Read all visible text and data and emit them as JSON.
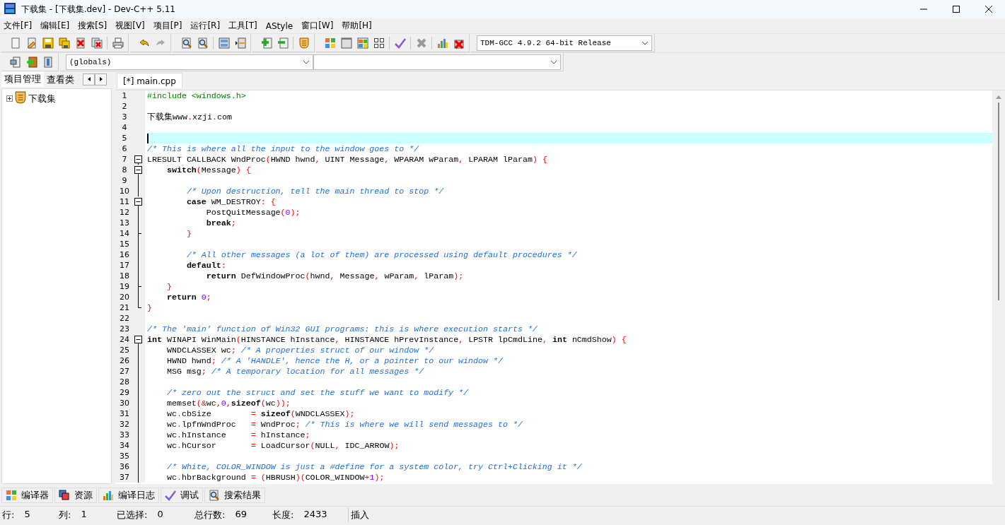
{
  "window": {
    "title": "下载集 - [下载集.dev] - Dev-C++ 5.11"
  },
  "menu": [
    "文件[F]",
    "编辑[E]",
    "搜索[S]",
    "视图[V]",
    "项目[P]",
    "运行[R]",
    "工具[T]",
    "AStyle",
    "窗口[W]",
    "帮助[H]"
  ],
  "toolbar": {
    "compiler": "TDM-GCC 4.9.2 64-bit Release"
  },
  "class_bar": {
    "scope": "(globals)"
  },
  "side_panel": {
    "tabs": [
      {
        "label": "项目管理",
        "selected": true
      },
      {
        "label": "查看类",
        "selected": false
      }
    ],
    "tree": [
      {
        "label": "下载集",
        "expanded": false
      }
    ]
  },
  "editor": {
    "tabs": [
      {
        "label": "[*] main.cpp",
        "selected": true
      }
    ],
    "lines": [
      {
        "number": "1",
        "kind": "plain",
        "current": false,
        "segments": [
          {
            "kind": "pp",
            "text": "#include <windows.h>"
          }
        ]
      },
      {
        "number": "2",
        "kind": "plain",
        "current": false
      },
      {
        "number": "3",
        "kind": "plain",
        "current": false,
        "segments": [
          {
            "kind": "pl",
            "text": "下载集www"
          },
          {
            "kind": "sym",
            "text": "."
          },
          {
            "kind": "pl",
            "text": "xzji"
          },
          {
            "kind": "sym",
            "text": "."
          },
          {
            "kind": "pl",
            "text": "com"
          }
        ]
      },
      {
        "number": "4",
        "kind": "plain",
        "current": false
      },
      {
        "number": "5",
        "kind": "plain",
        "current": true
      },
      {
        "number": "6",
        "kind": "plain",
        "current": false,
        "segments": [
          {
            "kind": "cm",
            "text": "/* This is where all the input to the window goes to */"
          }
        ]
      },
      {
        "number": "7",
        "kind": "fold-start",
        "current": false,
        "segments": [
          {
            "kind": "pl",
            "text": "LRESULT CALLBACK WndProc"
          },
          {
            "kind": "sym",
            "text": "("
          },
          {
            "kind": "pl",
            "text": "HWND hwnd"
          },
          {
            "kind": "sym",
            "text": ","
          },
          {
            "kind": "pl",
            "text": " UINT Message"
          },
          {
            "kind": "sym",
            "text": ","
          },
          {
            "kind": "pl",
            "text": " WPARAM wParam"
          },
          {
            "kind": "sym",
            "text": ","
          },
          {
            "kind": "pl",
            "text": " LPARAM lParam"
          },
          {
            "kind": "sym",
            "text": ")"
          },
          {
            "kind": "sym",
            "text": " {"
          }
        ]
      },
      {
        "number": "8",
        "kind": "fold-start",
        "current": false,
        "segments": [
          {
            "kind": "kw",
            "text": "    switch"
          },
          {
            "kind": "sym",
            "text": "("
          },
          {
            "kind": "pl",
            "text": "Message"
          },
          {
            "kind": "sym",
            "text": ")"
          },
          {
            "kind": "sym",
            "text": " {"
          }
        ]
      },
      {
        "number": "9",
        "kind": "fold-body",
        "current": false
      },
      {
        "number": "10",
        "kind": "fold-body",
        "current": false,
        "segments": [
          {
            "kind": "cm",
            "text": "        /* Upon destruction, tell the main thread to stop */"
          }
        ]
      },
      {
        "number": "11",
        "kind": "fold-start",
        "current": false,
        "segments": [
          {
            "kind": "kw",
            "text": "        case"
          },
          {
            "kind": "pl",
            "text": " WM_DESTROY"
          },
          {
            "kind": "sym",
            "text": ":"
          },
          {
            "kind": "sym",
            "text": " {"
          }
        ]
      },
      {
        "number": "12",
        "kind": "fold-body",
        "current": false,
        "segments": [
          {
            "kind": "pl",
            "text": "            PostQuitMessage"
          },
          {
            "kind": "sym",
            "text": "("
          },
          {
            "kind": "num",
            "text": "0"
          },
          {
            "kind": "sym",
            "text": ");"
          }
        ]
      },
      {
        "number": "13",
        "kind": "fold-body",
        "current": false,
        "segments": [
          {
            "kind": "kw",
            "text": "            break"
          },
          {
            "kind": "sym",
            "text": ";"
          }
        ]
      },
      {
        "number": "14",
        "kind": "fold-end",
        "current": false,
        "segments": [
          {
            "kind": "sym",
            "text": "        }"
          }
        ]
      },
      {
        "number": "15",
        "kind": "fold-body",
        "current": false
      },
      {
        "number": "16",
        "kind": "fold-body",
        "current": false,
        "segments": [
          {
            "kind": "cm",
            "text": "        /* All other messages (a lot of them) are processed using default procedures */"
          }
        ]
      },
      {
        "number": "17",
        "kind": "fold-body",
        "current": false,
        "segments": [
          {
            "kind": "kw",
            "text": "        default"
          },
          {
            "kind": "sym",
            "text": ":"
          }
        ]
      },
      {
        "number": "18",
        "kind": "fold-body",
        "current": false,
        "segments": [
          {
            "kind": "kw",
            "text": "            return"
          },
          {
            "kind": "pl",
            "text": " DefWindowProc"
          },
          {
            "kind": "sym",
            "text": "("
          },
          {
            "kind": "pl",
            "text": "hwnd"
          },
          {
            "kind": "sym",
            "text": ","
          },
          {
            "kind": "pl",
            "text": " Message"
          },
          {
            "kind": "sym",
            "text": ","
          },
          {
            "kind": "pl",
            "text": " wParam"
          },
          {
            "kind": "sym",
            "text": ","
          },
          {
            "kind": "pl",
            "text": " lParam"
          },
          {
            "kind": "sym",
            "text": ");"
          }
        ]
      },
      {
        "number": "19",
        "kind": "fold-end",
        "current": false,
        "segments": [
          {
            "kind": "sym",
            "text": "    }"
          }
        ]
      },
      {
        "number": "20",
        "kind": "fold-body",
        "current": false,
        "segments": [
          {
            "kind": "kw",
            "text": "    return"
          },
          {
            "kind": "num",
            "text": " 0"
          },
          {
            "kind": "sym",
            "text": ";"
          }
        ]
      },
      {
        "number": "21",
        "kind": "fold-last",
        "current": false,
        "segments": [
          {
            "kind": "sym",
            "text": "}"
          }
        ]
      },
      {
        "number": "22",
        "kind": "plain",
        "current": false
      },
      {
        "number": "23",
        "kind": "plain",
        "current": false,
        "segments": [
          {
            "kind": "cm",
            "text": "/* The 'main' function of Win32 GUI programs: this is where execution starts */"
          }
        ]
      },
      {
        "number": "24",
        "kind": "fold-start",
        "current": false,
        "segments": [
          {
            "kind": "kw",
            "text": "int"
          },
          {
            "kind": "pl",
            "text": " WINAPI WinMain"
          },
          {
            "kind": "sym",
            "text": "("
          },
          {
            "kind": "pl",
            "text": "HINSTANCE hInstance"
          },
          {
            "kind": "sym",
            "text": ","
          },
          {
            "kind": "pl",
            "text": " HINSTANCE hPrevInstance"
          },
          {
            "kind": "sym",
            "text": ","
          },
          {
            "kind": "pl",
            "text": " LPSTR lpCmdLine"
          },
          {
            "kind": "sym",
            "text": ","
          },
          {
            "kind": "kw",
            "text": " int"
          },
          {
            "kind": "pl",
            "text": " nCmdShow"
          },
          {
            "kind": "sym",
            "text": ")"
          },
          {
            "kind": "sym",
            "text": " {"
          }
        ]
      },
      {
        "number": "25",
        "kind": "fold-body",
        "current": false,
        "segments": [
          {
            "kind": "pl",
            "text": "    WNDCLASSEX wc"
          },
          {
            "kind": "sym",
            "text": ";"
          },
          {
            "kind": "cm",
            "text": " /* A properties struct of our window */"
          }
        ]
      },
      {
        "number": "26",
        "kind": "fold-body",
        "current": false,
        "segments": [
          {
            "kind": "pl",
            "text": "    HWND hwnd"
          },
          {
            "kind": "sym",
            "text": ";"
          },
          {
            "kind": "cm",
            "text": " /* A 'HANDLE', hence the H, or a pointer to our window */"
          }
        ]
      },
      {
        "number": "27",
        "kind": "fold-body",
        "current": false,
        "segments": [
          {
            "kind": "pl",
            "text": "    MSG msg"
          },
          {
            "kind": "sym",
            "text": ";"
          },
          {
            "kind": "cm",
            "text": " /* A temporary location for all messages */"
          }
        ]
      },
      {
        "number": "28",
        "kind": "fold-body",
        "current": false
      },
      {
        "number": "29",
        "kind": "fold-body",
        "current": false,
        "segments": [
          {
            "kind": "cm",
            "text": "    /* zero out the struct and set the stuff we want to modify */"
          }
        ]
      },
      {
        "number": "30",
        "kind": "fold-body",
        "current": false,
        "segments": [
          {
            "kind": "pl",
            "text": "    memset"
          },
          {
            "kind": "sym",
            "text": "(&"
          },
          {
            "kind": "pl",
            "text": "wc"
          },
          {
            "kind": "sym",
            "text": ","
          },
          {
            "kind": "num",
            "text": "0"
          },
          {
            "kind": "sym",
            "text": ","
          },
          {
            "kind": "kw",
            "text": "sizeof"
          },
          {
            "kind": "sym",
            "text": "("
          },
          {
            "kind": "pl",
            "text": "wc"
          },
          {
            "kind": "sym",
            "text": "));"
          }
        ]
      },
      {
        "number": "31",
        "kind": "fold-body",
        "current": false,
        "segments": [
          {
            "kind": "pl",
            "text": "    wc"
          },
          {
            "kind": "sym",
            "text": "."
          },
          {
            "kind": "pl",
            "text": "cbSize        "
          },
          {
            "kind": "sym",
            "text": "="
          },
          {
            "kind": "kw",
            "text": " sizeof"
          },
          {
            "kind": "sym",
            "text": "("
          },
          {
            "kind": "pl",
            "text": "WNDCLASSEX"
          },
          {
            "kind": "sym",
            "text": ");"
          }
        ]
      },
      {
        "number": "32",
        "kind": "fold-body",
        "current": false,
        "segments": [
          {
            "kind": "pl",
            "text": "    wc"
          },
          {
            "kind": "sym",
            "text": "."
          },
          {
            "kind": "pl",
            "text": "lpfnWndProc   "
          },
          {
            "kind": "sym",
            "text": "="
          },
          {
            "kind": "pl",
            "text": " WndProc"
          },
          {
            "kind": "sym",
            "text": ";"
          },
          {
            "kind": "cm",
            "text": " /* This is where we will send messages to */"
          }
        ]
      },
      {
        "number": "33",
        "kind": "fold-body",
        "current": false,
        "segments": [
          {
            "kind": "pl",
            "text": "    wc"
          },
          {
            "kind": "sym",
            "text": "."
          },
          {
            "kind": "pl",
            "text": "hInstance     "
          },
          {
            "kind": "sym",
            "text": "="
          },
          {
            "kind": "pl",
            "text": " hInstance"
          },
          {
            "kind": "sym",
            "text": ";"
          }
        ]
      },
      {
        "number": "34",
        "kind": "fold-body",
        "current": false,
        "segments": [
          {
            "kind": "pl",
            "text": "    wc"
          },
          {
            "kind": "sym",
            "text": "."
          },
          {
            "kind": "pl",
            "text": "hCursor       "
          },
          {
            "kind": "sym",
            "text": "="
          },
          {
            "kind": "pl",
            "text": " LoadCursor"
          },
          {
            "kind": "sym",
            "text": "("
          },
          {
            "kind": "pl",
            "text": "NULL"
          },
          {
            "kind": "sym",
            "text": ","
          },
          {
            "kind": "pl",
            "text": " IDC_ARROW"
          },
          {
            "kind": "sym",
            "text": ");"
          }
        ]
      },
      {
        "number": "35",
        "kind": "fold-body",
        "current": false
      },
      {
        "number": "36",
        "kind": "fold-body",
        "current": false,
        "segments": [
          {
            "kind": "cm",
            "text": "    /* White, COLOR_WINDOW is just a #define for a system color, try Ctrl+Clicking it */"
          }
        ]
      },
      {
        "number": "37",
        "kind": "fold-body",
        "current": false,
        "segments": [
          {
            "kind": "pl",
            "text": "    wc"
          },
          {
            "kind": "sym",
            "text": "."
          },
          {
            "kind": "pl",
            "text": "hbrBackground "
          },
          {
            "kind": "sym",
            "text": "="
          },
          {
            "kind": "sym",
            "text": " ("
          },
          {
            "kind": "pl",
            "text": "HBRUSH"
          },
          {
            "kind": "sym",
            "text": ")("
          },
          {
            "kind": "pl",
            "text": "COLOR_WINDOW"
          },
          {
            "kind": "sym",
            "text": "+"
          },
          {
            "kind": "num",
            "text": "1"
          },
          {
            "kind": "sym",
            "text": ");"
          }
        ]
      }
    ]
  },
  "bottom_tabs": [
    {
      "label": "编译器"
    },
    {
      "label": "资源"
    },
    {
      "label": "编译日志"
    },
    {
      "label": "调试"
    },
    {
      "label": "搜索结果"
    }
  ],
  "status_bar": [
    {
      "label": "行:",
      "value": "5"
    },
    {
      "label": "列:",
      "value": "1"
    },
    {
      "label": "已选择:",
      "value": "0"
    },
    {
      "label": "总行数:",
      "value": "69"
    },
    {
      "label": "长度:",
      "value": "2433"
    },
    {
      "label": "插入"
    }
  ]
}
